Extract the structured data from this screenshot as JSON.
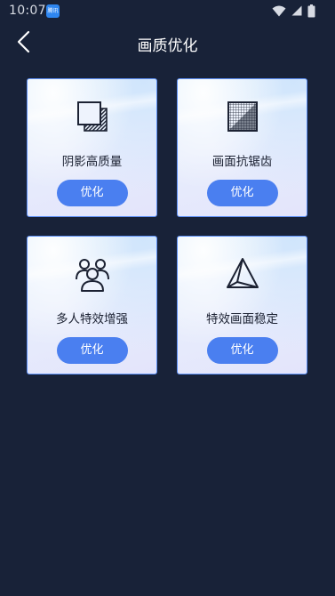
{
  "status_bar": {
    "time": "10:07",
    "app_icon_label": "腾讯"
  },
  "header": {
    "title": "画质优化"
  },
  "cards": [
    {
      "title": "阴影高质量",
      "icon": "shadow-squares-icon",
      "button_label": "优化"
    },
    {
      "title": "画面抗锯齿",
      "icon": "antialias-pixel-icon",
      "button_label": "优化"
    },
    {
      "title": "多人特效增强",
      "icon": "multi-user-icon",
      "button_label": "优化"
    },
    {
      "title": "特效画面稳定",
      "icon": "pyramid-icon",
      "button_label": "优化"
    }
  ],
  "colors": {
    "background": "#182238",
    "card_border": "#5c8ff5",
    "button": "#4a7ff0",
    "card_text": "#1c2233"
  }
}
